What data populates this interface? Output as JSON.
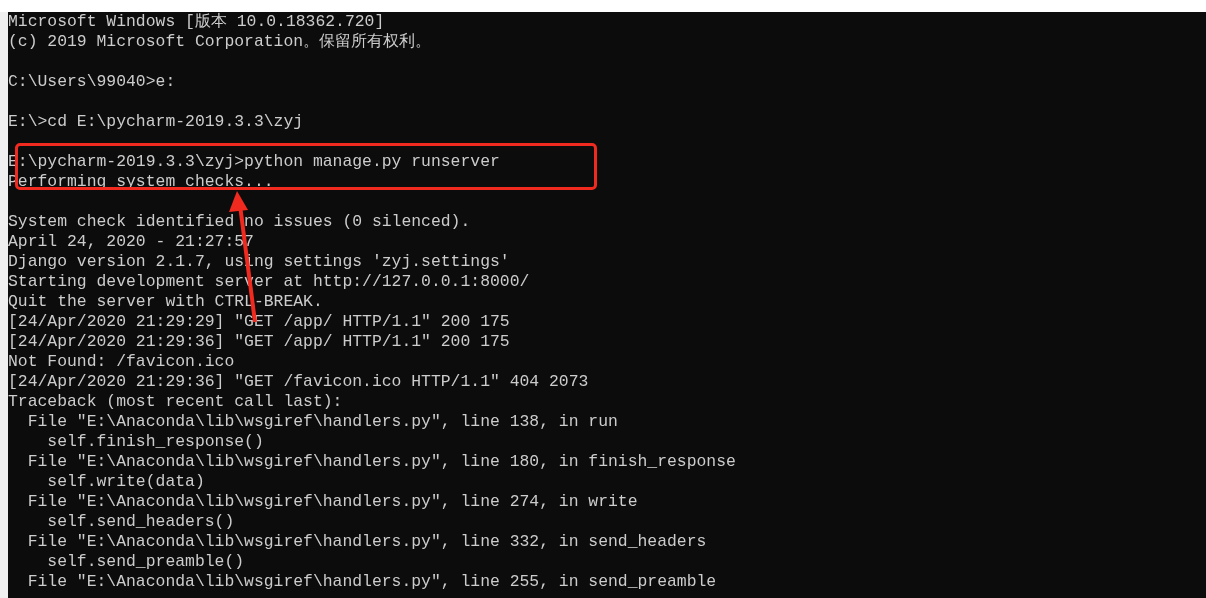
{
  "console": {
    "lines": [
      {
        "kind": "text",
        "text": "Microsoft Windows [版本 10.0.18362.720]"
      },
      {
        "kind": "text",
        "text": "(c) 2019 Microsoft Corporation。保留所有权利。"
      },
      {
        "kind": "blank"
      },
      {
        "kind": "text",
        "text": "C:\\Users\\99040>e:"
      },
      {
        "kind": "blank"
      },
      {
        "kind": "text",
        "text": "E:\\>cd E:\\pycharm-2019.3.3\\zyj"
      },
      {
        "kind": "blank"
      },
      {
        "kind": "text",
        "text": "E:\\pycharm-2019.3.3\\zyj>python manage.py runserver"
      },
      {
        "kind": "text",
        "text": "Performing system checks..."
      },
      {
        "kind": "blank"
      },
      {
        "kind": "text",
        "text": "System check identified no issues (0 silenced)."
      },
      {
        "kind": "text",
        "text": "April 24, 2020 - 21:27:57"
      },
      {
        "kind": "text",
        "text": "Django version 2.1.7, using settings 'zyj.settings'"
      },
      {
        "kind": "text",
        "text": "Starting development server at http://127.0.0.1:8000/"
      },
      {
        "kind": "text",
        "text": "Quit the server with CTRL-BREAK."
      },
      {
        "kind": "text",
        "text": "[24/Apr/2020 21:29:29] \"GET /app/ HTTP/1.1\" 200 175"
      },
      {
        "kind": "text",
        "text": "[24/Apr/2020 21:29:36] \"GET /app/ HTTP/1.1\" 200 175"
      },
      {
        "kind": "text",
        "text": "Not Found: /favicon.ico"
      },
      {
        "kind": "text",
        "text": "[24/Apr/2020 21:29:36] \"GET /favicon.ico HTTP/1.1\" 404 2073"
      },
      {
        "kind": "text",
        "text": "Traceback (most recent call last):"
      },
      {
        "kind": "text",
        "text": "  File \"E:\\Anaconda\\lib\\wsgiref\\handlers.py\", line 138, in run"
      },
      {
        "kind": "text",
        "text": "    self.finish_response()"
      },
      {
        "kind": "text",
        "text": "  File \"E:\\Anaconda\\lib\\wsgiref\\handlers.py\", line 180, in finish_response"
      },
      {
        "kind": "text",
        "text": "    self.write(data)"
      },
      {
        "kind": "text",
        "text": "  File \"E:\\Anaconda\\lib\\wsgiref\\handlers.py\", line 274, in write"
      },
      {
        "kind": "text",
        "text": "    self.send_headers()"
      },
      {
        "kind": "text",
        "text": "  File \"E:\\Anaconda\\lib\\wsgiref\\handlers.py\", line 332, in send_headers"
      },
      {
        "kind": "text",
        "text": "    self.send_preamble()"
      },
      {
        "kind": "text",
        "text": "  File \"E:\\Anaconda\\lib\\wsgiref\\handlers.py\", line 255, in send_preamble"
      }
    ]
  }
}
